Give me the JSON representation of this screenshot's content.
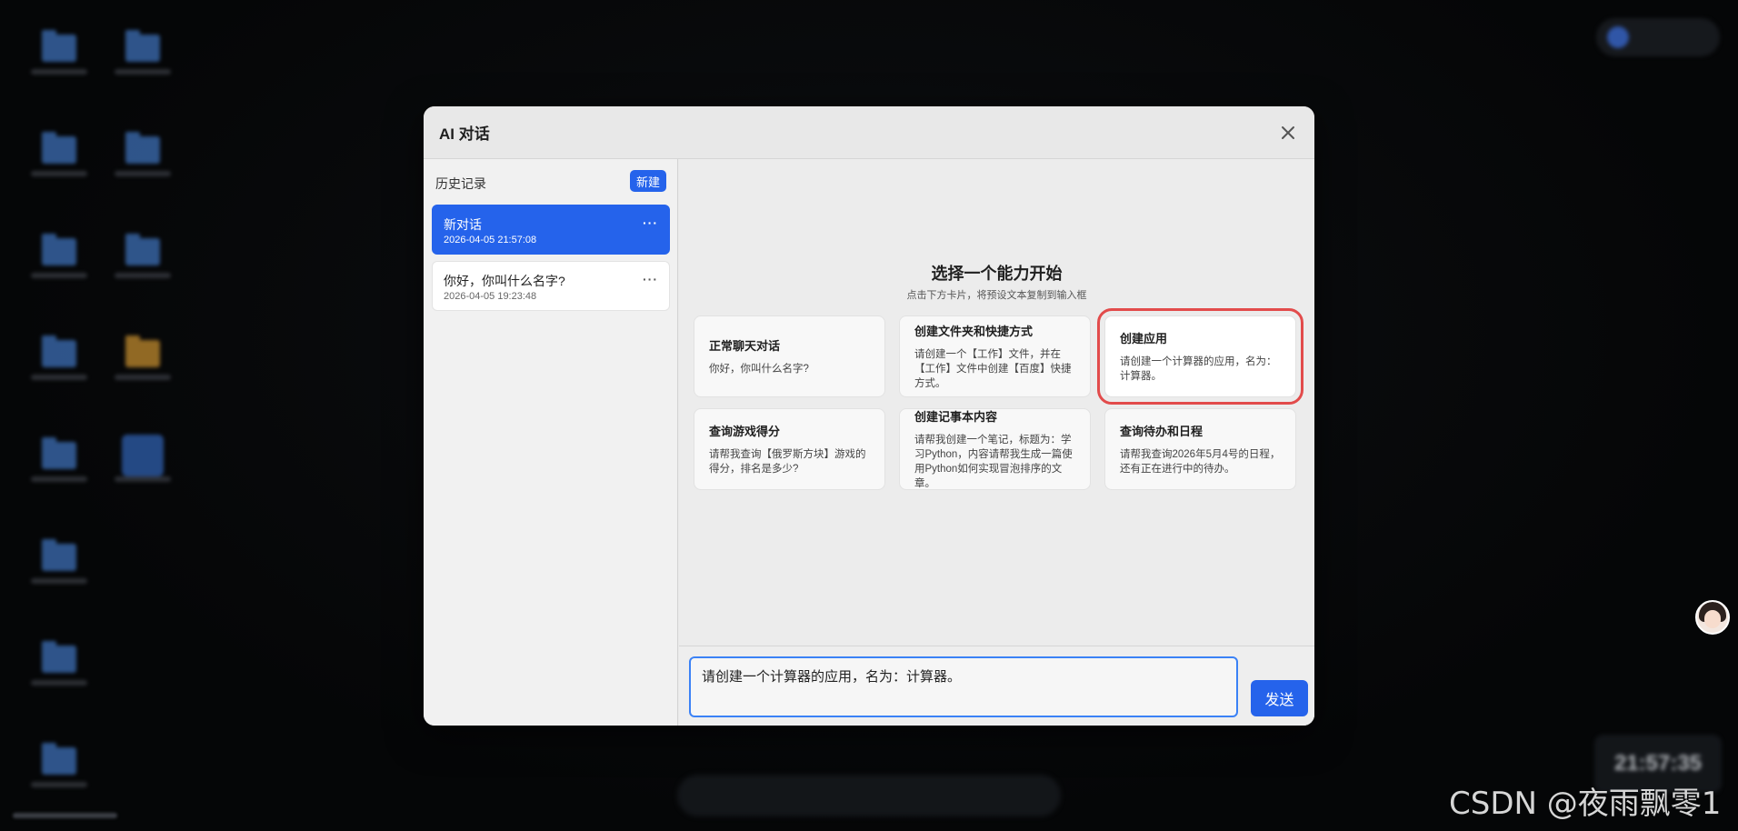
{
  "dialog": {
    "title": "AI 对话",
    "close_icon": "close-icon"
  },
  "sidebar": {
    "history_label": "历史记录",
    "new_button": "新建",
    "conversations": [
      {
        "title": "新对话",
        "time": "2026-04-05 21:57:08",
        "more": "···",
        "active": true
      },
      {
        "title": "你好，你叫什么名字?",
        "time": "2026-04-05 19:23:48",
        "more": "···",
        "active": false
      }
    ]
  },
  "main": {
    "title": "选择一个能力开始",
    "subtitle": "点击下方卡片，将预设文本复制到输入框",
    "cards": [
      {
        "title": "正常聊天对话",
        "desc": "你好，你叫什么名字?"
      },
      {
        "title": "创建文件夹和快捷方式",
        "desc": "请创建一个【工作】文件，并在【工作】文件中创建【百度】快捷方式。"
      },
      {
        "title": "创建应用",
        "desc": "请创建一个计算器的应用，名为：计算器。",
        "highlighted": true
      },
      {
        "title": "查询游戏得分",
        "desc": "请帮我查询【俄罗斯方块】游戏的得分，排名是多少?"
      },
      {
        "title": "创建记事本内容",
        "desc": "请帮我创建一个笔记，标题为：学习Python，内容请帮我生成一篇使用Python如何实现冒泡排序的文章。"
      },
      {
        "title": "查询待办和日程",
        "desc": "请帮我查询2026年5月4号的日程，还有正在进行中的待办。"
      }
    ]
  },
  "input": {
    "value": "请创建一个计算器的应用，名为：计算器。",
    "send_label": "发送"
  },
  "desktop": {
    "clock": "21:57:35",
    "watermark": "CSDN @夜雨飘零1"
  },
  "colors": {
    "accent": "#2563eb",
    "highlight_border": "#e24b4b"
  }
}
